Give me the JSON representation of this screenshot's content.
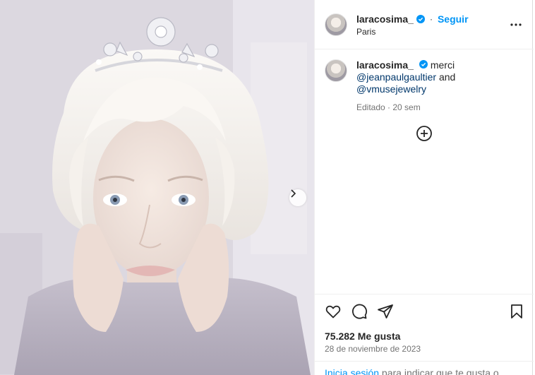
{
  "post": {
    "author": {
      "username": "laracosima_",
      "verified": true,
      "location": "Paris"
    },
    "header": {
      "separator": "·",
      "follow_label": "Seguir"
    },
    "caption": {
      "username": "laracosima_",
      "text_start": "merci",
      "mention_1": "@jeanpaulgaultier",
      "conjunction": "and",
      "mention_2": "@vmusejewelry",
      "meta": "Editado · 20 sem"
    },
    "stats": {
      "likes": "75.282 Me gusta",
      "date": "28 de noviembre de 2023"
    },
    "login_prompt": {
      "link": "Inicia sesión",
      "text": " para indicar que te gusta o"
    },
    "icons": {
      "more": "more-horizontal-icon",
      "add_comment": "add-circle-icon",
      "like": "heart-icon",
      "comment": "comment-bubble-icon",
      "share": "paper-plane-icon",
      "save": "bookmark-icon",
      "carousel_next": "chevron-right-icon",
      "verified": "verified-badge-icon"
    },
    "colors": {
      "link_blue": "#0095f6",
      "mention_blue": "#00376b",
      "verified_blue": "#0095f6",
      "secondary_text": "#737373"
    }
  }
}
